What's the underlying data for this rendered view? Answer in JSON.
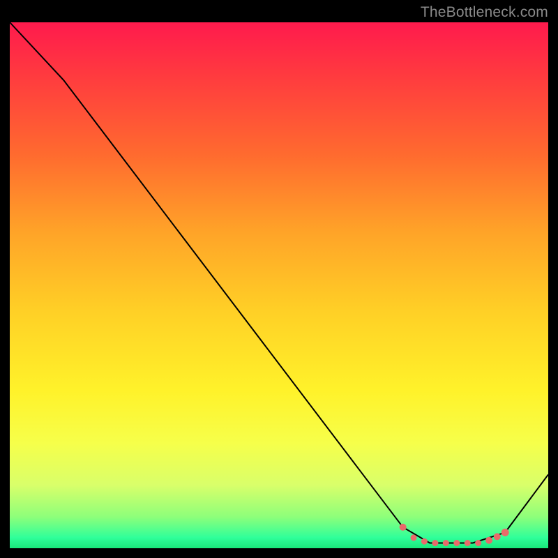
{
  "watermark": "TheBottleneck.com",
  "colors": {
    "line": "#000000",
    "marker": "#e86a6a",
    "frame": "#000000"
  },
  "chart_data": {
    "type": "line",
    "title": "",
    "xlabel": "",
    "ylabel": "",
    "xlim": [
      0,
      100
    ],
    "ylim": [
      0,
      100
    ],
    "grid": false,
    "legend": false,
    "x": [
      0,
      10,
      73,
      78,
      86,
      92,
      100
    ],
    "values": [
      100,
      89,
      4,
      1,
      1,
      3,
      14
    ],
    "markers": {
      "x": [
        73,
        75,
        77,
        79,
        81,
        83,
        85,
        87,
        89,
        90.5,
        92
      ],
      "values": [
        4,
        2,
        1.3,
        1,
        1,
        1,
        1,
        1,
        1.5,
        2.2,
        3
      ],
      "size": [
        10,
        9,
        9,
        9,
        9,
        9,
        9,
        9,
        10,
        10,
        11
      ]
    }
  }
}
